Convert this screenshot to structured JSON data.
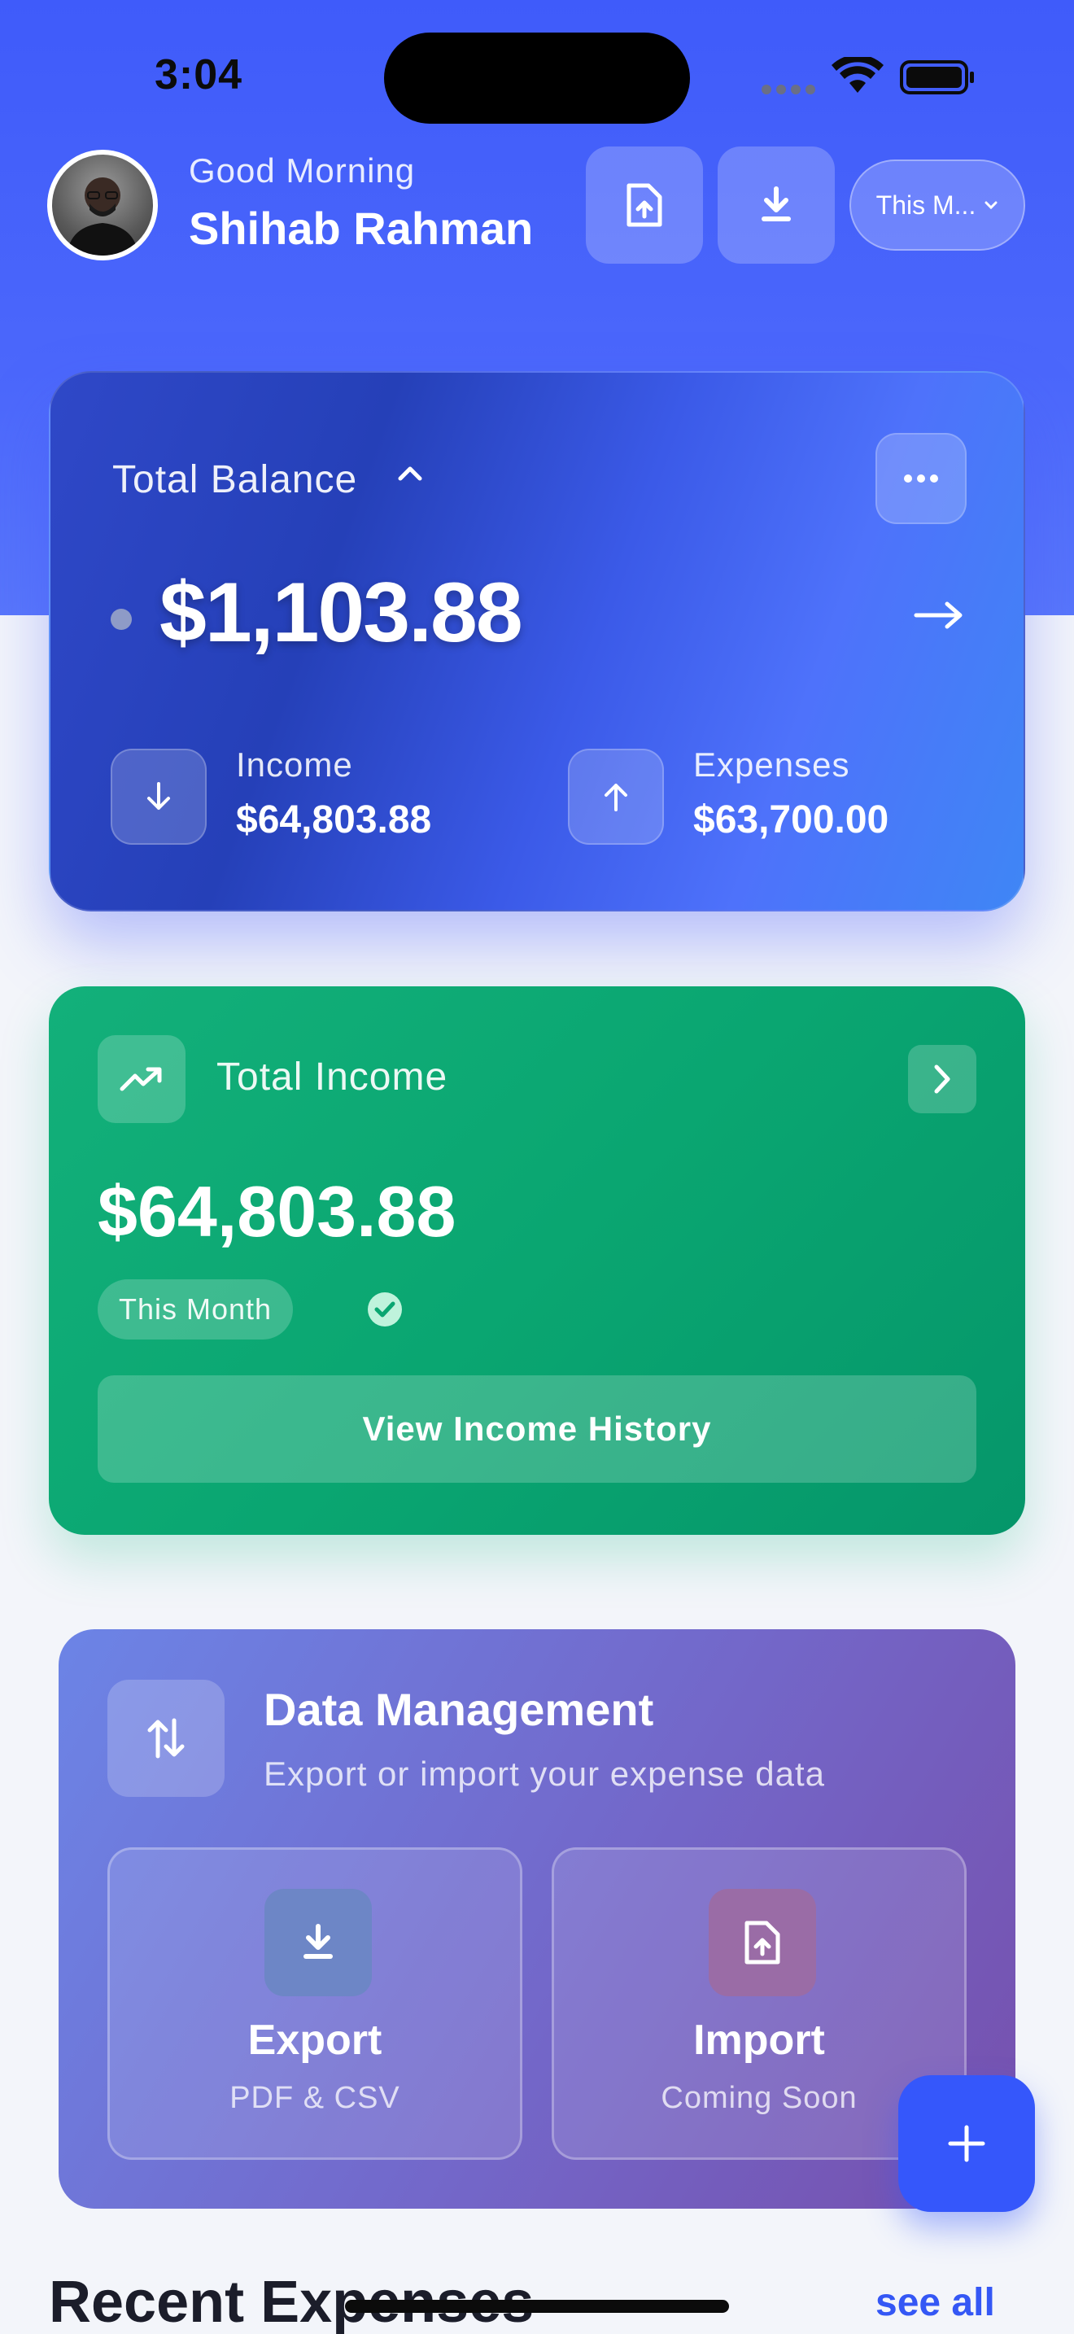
{
  "status_bar": {
    "time": "3:04"
  },
  "header": {
    "greeting": "Good Morning",
    "user_name": "Shihab Rahman",
    "period_label": "This M..."
  },
  "balance_card": {
    "title": "Total Balance",
    "amount": "$1,103.88",
    "income_label": "Income",
    "income_value": "$64,803.88",
    "expenses_label": "Expenses",
    "expenses_value": "$63,700.00"
  },
  "income_card": {
    "title": "Total Income",
    "amount": "$64,803.88",
    "period_badge": "This Month",
    "button_label": "View Income History",
    "accent_color": "#10b981"
  },
  "data_management": {
    "title": "Data Management",
    "subtitle": "Export or import your expense data",
    "export_title": "Export",
    "export_sub": "PDF & CSV",
    "import_title": "Import",
    "import_sub": "Coming Soon"
  },
  "recent": {
    "title": "Recent Expenses",
    "see_all": "see all"
  },
  "colors": {
    "primary": "#3f5bfa",
    "income_green": "#0aa671",
    "data_purple": "#7367c9"
  },
  "icons": [
    "file-upload-icon",
    "download-icon",
    "chevron-down-icon",
    "more-icon",
    "arrow-right-icon",
    "arrow-down-icon",
    "arrow-up-icon",
    "trend-up-icon",
    "chevron-right-icon",
    "check-circle-icon",
    "swap-vertical-icon",
    "plus-icon"
  ]
}
